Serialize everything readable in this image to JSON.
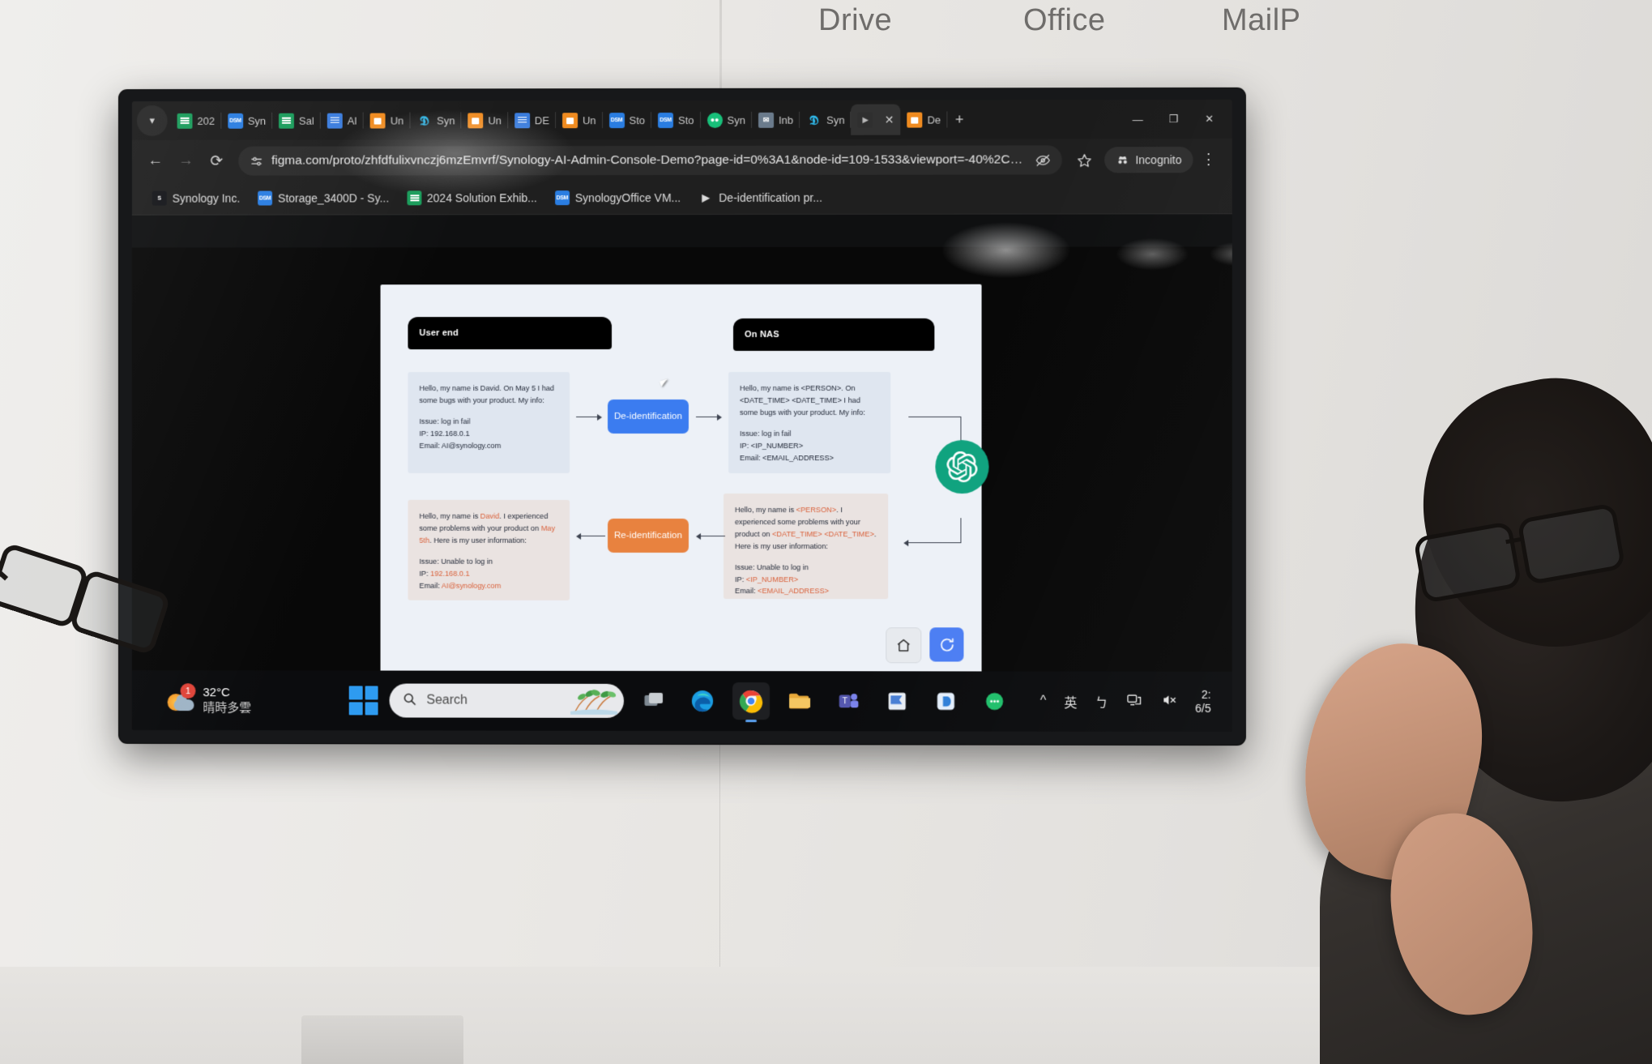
{
  "environment": {
    "wall_signs": [
      {
        "label": "Drive"
      },
      {
        "label": "Office"
      },
      {
        "label": "MailP"
      }
    ]
  },
  "browser": {
    "tab_list_icon": "chevron-down-icon",
    "tabs": [
      {
        "label": "202",
        "icon": "google-sheets-icon",
        "type": "sheets"
      },
      {
        "label": "Syn",
        "icon": "dsm-icon",
        "type": "dsm"
      },
      {
        "label": "Sal",
        "icon": "google-sheets-icon",
        "type": "sheets"
      },
      {
        "label": "AI ",
        "icon": "google-docs-icon",
        "type": "docs"
      },
      {
        "label": "Un",
        "icon": "google-slides-icon",
        "type": "slides"
      },
      {
        "label": "Syn",
        "icon": "synology-drive-icon",
        "type": "syn"
      },
      {
        "label": "Un",
        "icon": "google-slides-icon",
        "type": "slides"
      },
      {
        "label": "DE",
        "icon": "google-docs-icon",
        "type": "docs"
      },
      {
        "label": "Un",
        "icon": "google-slides-icon",
        "type": "slides"
      },
      {
        "label": "Sto",
        "icon": "dsm-icon",
        "type": "dsm"
      },
      {
        "label": "Sto",
        "icon": "dsm-icon",
        "type": "dsm"
      },
      {
        "label": "Syn",
        "icon": "synology-chat-icon",
        "type": "chat"
      },
      {
        "label": "Inb",
        "icon": "mail-icon",
        "type": "mail"
      },
      {
        "label": "Syn",
        "icon": "synology-drive-icon",
        "type": "syn"
      },
      {
        "label": "",
        "icon": "play-icon",
        "type": "play",
        "active": true
      },
      {
        "label": "De",
        "icon": "figma-icon",
        "type": "slides"
      }
    ],
    "tab_close_label": "✕",
    "new_tab_label": "+",
    "window_controls": {
      "minimize": "—",
      "maximize": "❐",
      "close": "✕"
    },
    "toolbar": {
      "back_label": "←",
      "forward_label": "→",
      "reload_label": "⟳",
      "site_settings_icon": "tune-icon",
      "url": "figma.com/proto/zhfdfulixvnczj6mzEmvrf/Synology-AI-Admin-Console-Demo?page-id=0%3A1&node-id=109-1533&viewport=-40%2C627%2C...",
      "hidden_icon": "eye-off-icon",
      "bookmark_icon": "star-icon",
      "incognito_label": "Incognito",
      "incognito_icon": "incognito-icon",
      "menu_label": "⋮"
    },
    "bookmarks": [
      {
        "label": "Synology Inc.",
        "icon": "synology-s-icon",
        "type": "s"
      },
      {
        "label": "Storage_3400D - Sy...",
        "icon": "dsm-icon",
        "type": "dsm"
      },
      {
        "label": "2024 Solution Exhib...",
        "icon": "google-sheets-icon",
        "type": "sheets"
      },
      {
        "label": "SynologyOffice VM...",
        "icon": "dsm-icon",
        "type": "dsm"
      },
      {
        "label": "De-identification pr...",
        "icon": "folder-arrow-icon",
        "type": "arrow"
      }
    ]
  },
  "prototype": {
    "lanes": [
      {
        "title": "User end"
      },
      {
        "title": "On NAS"
      }
    ],
    "user_request": {
      "line1": "Hello, my name is David. On May 5 I had some bugs with your product. My info:",
      "line2": "Issue: log in fail",
      "line3": "IP: 192.168.0.1",
      "line4": "Email: AI@synology.com"
    },
    "nas_deidentified": {
      "line1": "Hello, my name is <PERSON>. On <DATE_TIME> <DATE_TIME> I had some bugs with your product. My info:",
      "line2": "Issue: log in fail",
      "line3": "IP: <IP_NUMBER>",
      "line4": "Email: <EMAIL_ADDRESS>"
    },
    "nas_response": {
      "p1_a": "Hello, my name is ",
      "p1_person": "<PERSON>",
      "p1_b": ". I experienced some problems with your product on ",
      "p1_date1": "<DATE_TIME>",
      "p1_date2": "<DATE_TIME>",
      "p1_c": ". Here is my user information:",
      "issue": "Issue: Unable to log in",
      "ip_label": "IP: ",
      "ip_value": "<IP_NUMBER>",
      "email_label": "Email: ",
      "email_value": "<EMAIL_ADDRESS>"
    },
    "user_response": {
      "p1_a": "Hello, my name is ",
      "p1_person": "David",
      "p1_b": ". I experienced some problems with your product on ",
      "p1_date": "May 5th",
      "p1_c": ". Here is my user information:",
      "issue": "Issue: Unable to log in",
      "ip_label": "IP: ",
      "ip_value": "192.168.0.1",
      "email_label": "Email: ",
      "email_value": "AI@synology.com"
    },
    "deidentify_button": "De-identification",
    "reidentify_button": "Re-identification",
    "llm_badge_icon": "openai-icon",
    "home_button_icon": "home-icon",
    "reload_button_icon": "reload-icon",
    "colors": {
      "deidentify": "#3b7cf0",
      "reidentify": "#e8823f",
      "highlight": "#d9613b",
      "openai": "#10a37f",
      "canvas": "#edf1f7",
      "box_cool": "#dfe6f0",
      "box_warm": "#eae3e1"
    }
  },
  "taskbar": {
    "weather": {
      "temperature": "32°C",
      "description": "晴時多雲",
      "badge": "1",
      "icon": "sun-cloud-icon"
    },
    "start_icon": "windows-start-icon",
    "search": {
      "placeholder": "Search",
      "icon": "search-icon"
    },
    "apps": [
      {
        "name": "task-view",
        "icon": "task-view-icon"
      },
      {
        "name": "edge",
        "icon": "edge-icon"
      },
      {
        "name": "chrome",
        "icon": "chrome-icon",
        "active": true
      },
      {
        "name": "file-explorer",
        "icon": "folder-icon"
      },
      {
        "name": "teams",
        "icon": "teams-icon"
      },
      {
        "name": "onenote",
        "icon": "onenote-icon"
      },
      {
        "name": "synology-drive",
        "icon": "synology-drive-icon"
      },
      {
        "name": "synology-chat",
        "icon": "synology-chat-icon"
      }
    ],
    "tray": [
      {
        "name": "show-hidden-icons",
        "glyph": "^"
      },
      {
        "name": "ime-mode",
        "glyph": "英"
      },
      {
        "name": "ime-bopomofo",
        "glyph": "ㄅ"
      },
      {
        "name": "network",
        "glyph": "network-icon"
      },
      {
        "name": "volume-muted",
        "glyph": "volume-mute-icon"
      }
    ],
    "clock": {
      "time": "2:",
      "date": "6/5"
    }
  }
}
